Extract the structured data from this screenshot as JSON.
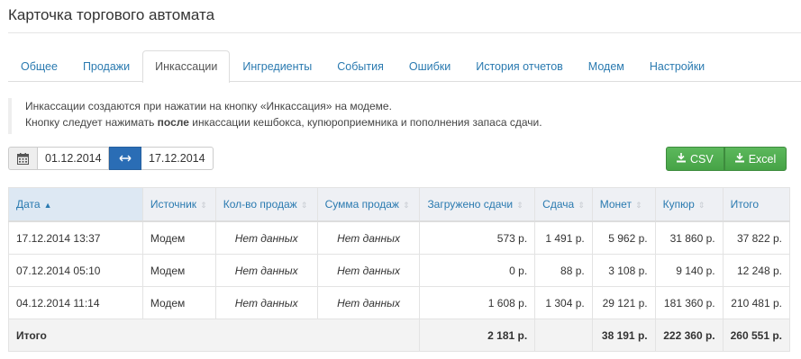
{
  "page_title": "Карточка торгового автомата",
  "tabs": [
    {
      "label": "Общее"
    },
    {
      "label": "Продажи"
    },
    {
      "label": "Инкассации"
    },
    {
      "label": "Ингредиенты"
    },
    {
      "label": "События"
    },
    {
      "label": "Ошибки"
    },
    {
      "label": "История отчетов"
    },
    {
      "label": "Модем"
    },
    {
      "label": "Настройки"
    }
  ],
  "active_tab": "Инкассации",
  "note": {
    "line1": "Инкассации создаются при нажатии на кнопку «Инкассация» на модеме.",
    "line2_pre": "Кнопку следует нажимать ",
    "line2_bold": "после",
    "line2_post": " инкассации кешбокса, купюроприемника и пополнения запаса сдачи."
  },
  "date_range": {
    "from": "01.12.2014",
    "to": "17.12.2014",
    "calendar_icon": "calendar-icon",
    "separator_icon": "arrows-horizontal-icon"
  },
  "export": {
    "csv_label": "CSV",
    "excel_label": "Excel",
    "icon": "download-icon"
  },
  "table": {
    "columns": [
      "Дата",
      "Источник",
      "Кол-во продаж",
      "Сумма продаж",
      "Загружено сдачи",
      "Сдача",
      "Монет",
      "Купюр",
      "Итого"
    ],
    "rows": [
      [
        "17.12.2014 13:37",
        "Модем",
        "Нет данных",
        "Нет данных",
        "573 р.",
        "1 491 р.",
        "5 962 р.",
        "31 860 р.",
        "37 822 р."
      ],
      [
        "07.12.2014 05:10",
        "Модем",
        "Нет данных",
        "Нет данных",
        "0 р.",
        "88 р.",
        "3 108 р.",
        "9 140 р.",
        "12 248 р."
      ],
      [
        "04.12.2014 11:14",
        "Модем",
        "Нет данных",
        "Нет данных",
        "1 608 р.",
        "1 304 р.",
        "29 121 р.",
        "181 360 р.",
        "210 481 р."
      ]
    ],
    "total": {
      "label": "Итого",
      "loaded": "2 181 р.",
      "change": "",
      "coins": "38 191 р.",
      "bills": "222 360 р.",
      "sum": "260 551 р."
    }
  },
  "colors": {
    "link": "#2a7ab0",
    "accent": "#2a6db5",
    "export": "#5cb85c"
  }
}
